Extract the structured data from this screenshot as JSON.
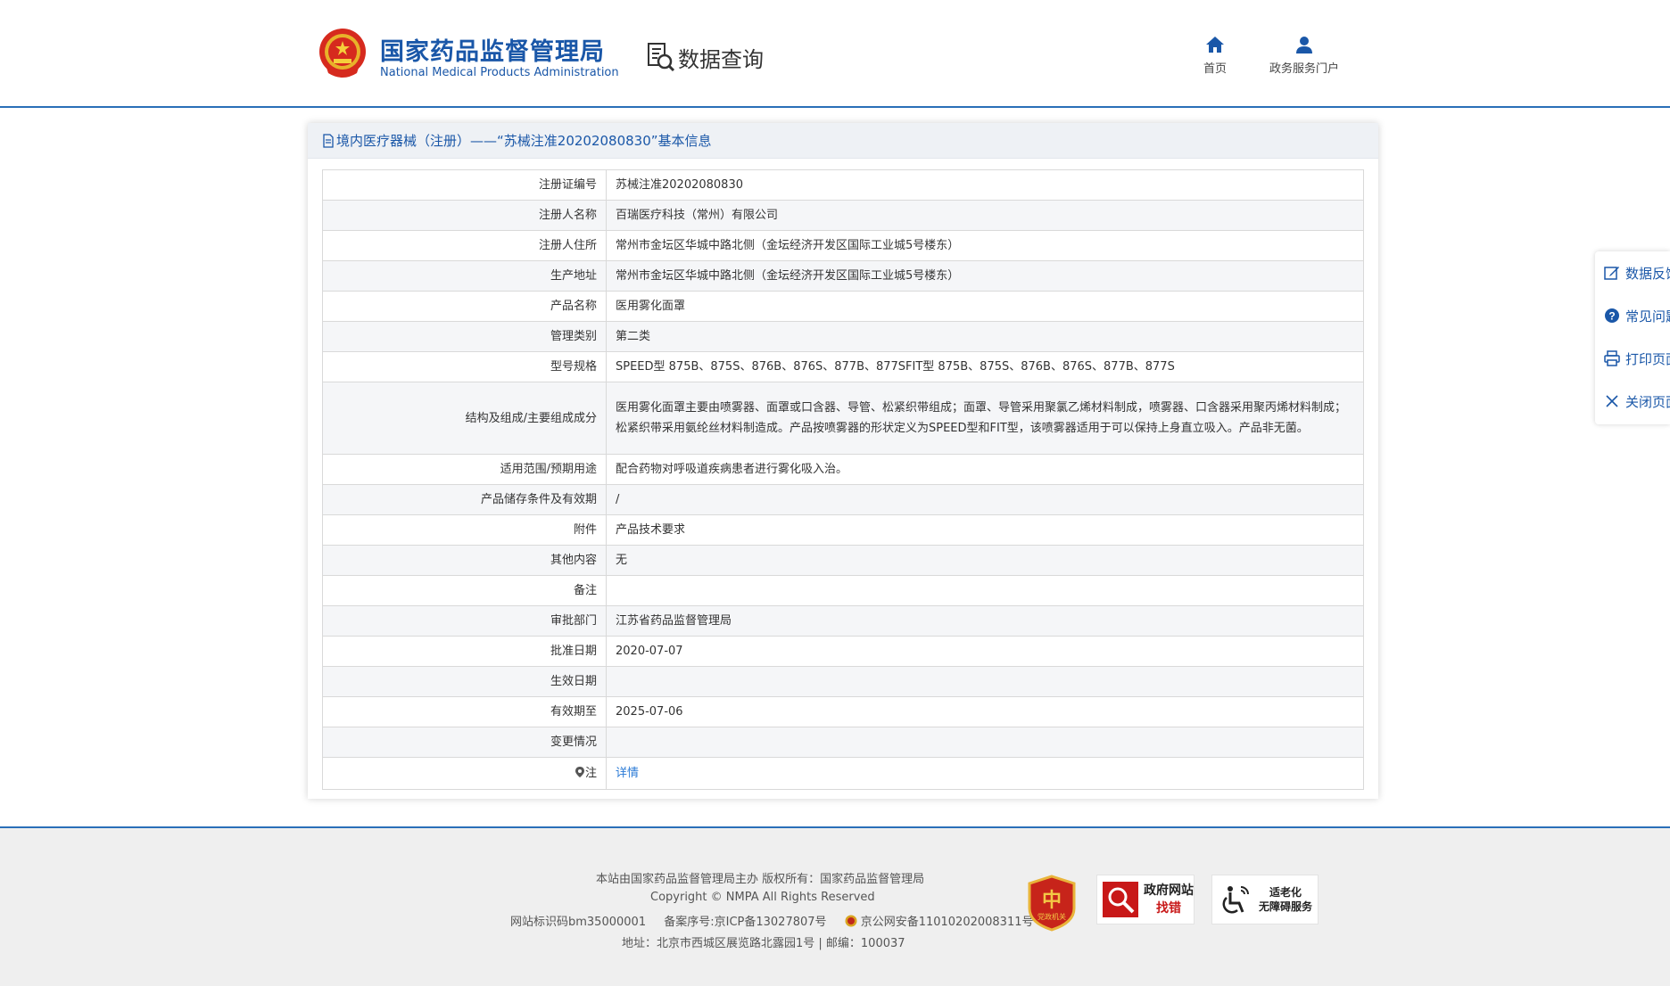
{
  "header": {
    "brand_cn": "国家药品监督管理局",
    "brand_en": "National Medical Products Administration",
    "query_title": "数据查询",
    "nav": [
      {
        "label": "首页",
        "icon": "home-icon"
      },
      {
        "label": "政务服务门户",
        "icon": "user-icon"
      }
    ],
    "accent_color": "#1a57a8"
  },
  "panel": {
    "title": "境内医疗器械（注册）——“苏械注准20202080830”基本信息",
    "rows": [
      {
        "label": "注册证编号",
        "value": "苏械注准20202080830"
      },
      {
        "label": "注册人名称",
        "value": "百瑞医疗科技（常州）有限公司"
      },
      {
        "label": "注册人住所",
        "value": "常州市金坛区华城中路北侧（金坛经济开发区国际工业城5号楼东）"
      },
      {
        "label": "生产地址",
        "value": "常州市金坛区华城中路北侧（金坛经济开发区国际工业城5号楼东）"
      },
      {
        "label": "产品名称",
        "value": "医用雾化面罩"
      },
      {
        "label": "管理类别",
        "value": "第二类"
      },
      {
        "label": "型号规格",
        "value": "SPEED型 875B、875S、876B、876S、877B、877SFIT型 875B、875S、876B、876S、877B、877S"
      },
      {
        "label": "结构及组成/主要组成成分",
        "value": "医用雾化面罩主要由喷雾器、面罩或口含器、导管、松紧织带组成；面罩、导管采用聚氯乙烯材料制成，喷雾器、口含器采用聚丙烯材料制成；松紧织带采用氨纶丝材料制造成。产品按喷雾器的形状定义为SPEED型和FIT型，该喷雾器适用于可以保持上身直立吸入。产品非无菌。"
      },
      {
        "label": "适用范围/预期用途",
        "value": "配合药物对呼吸道疾病患者进行雾化吸入治。"
      },
      {
        "label": "产品储存条件及有效期",
        "value": "/"
      },
      {
        "label": "附件",
        "value": "产品技术要求"
      },
      {
        "label": "其他内容",
        "value": "无"
      },
      {
        "label": "备注",
        "value": ""
      },
      {
        "label": "审批部门",
        "value": "江苏省药品监督管理局"
      },
      {
        "label": "批准日期",
        "value": "2020-07-07"
      },
      {
        "label": "生效日期",
        "value": ""
      },
      {
        "label": "有效期至",
        "value": "2025-07-06"
      },
      {
        "label": "变更情况",
        "value": ""
      }
    ],
    "note_label": "注",
    "note_link": "详情"
  },
  "sidebar": {
    "items": [
      {
        "label": "数据反馈",
        "icon": "edit-icon"
      },
      {
        "label": "常见问题",
        "icon": "question-icon"
      },
      {
        "label": "打印页面",
        "icon": "print-icon"
      },
      {
        "label": "关闭页面",
        "icon": "close-icon"
      }
    ]
  },
  "footer": {
    "line1": "本站由国家药品监督管理局主办 版权所有：国家药品监督管理局",
    "line2": "Copyright © NMPA All Rights Reserved",
    "site_id": "网站标识码bm35000001",
    "icp": "备案序号:京ICP备13027807号",
    "police": "京公网安备11010202008311号",
    "address": "地址：北京市西城区展览路北露园1号 | 邮编：100037",
    "badge_party": "党政机关",
    "badge_jiucuo_title": "政府网站",
    "badge_jiucuo_sub": "找错",
    "badge_access_line1": "适老化",
    "badge_access_line2": "无障碍服务"
  }
}
